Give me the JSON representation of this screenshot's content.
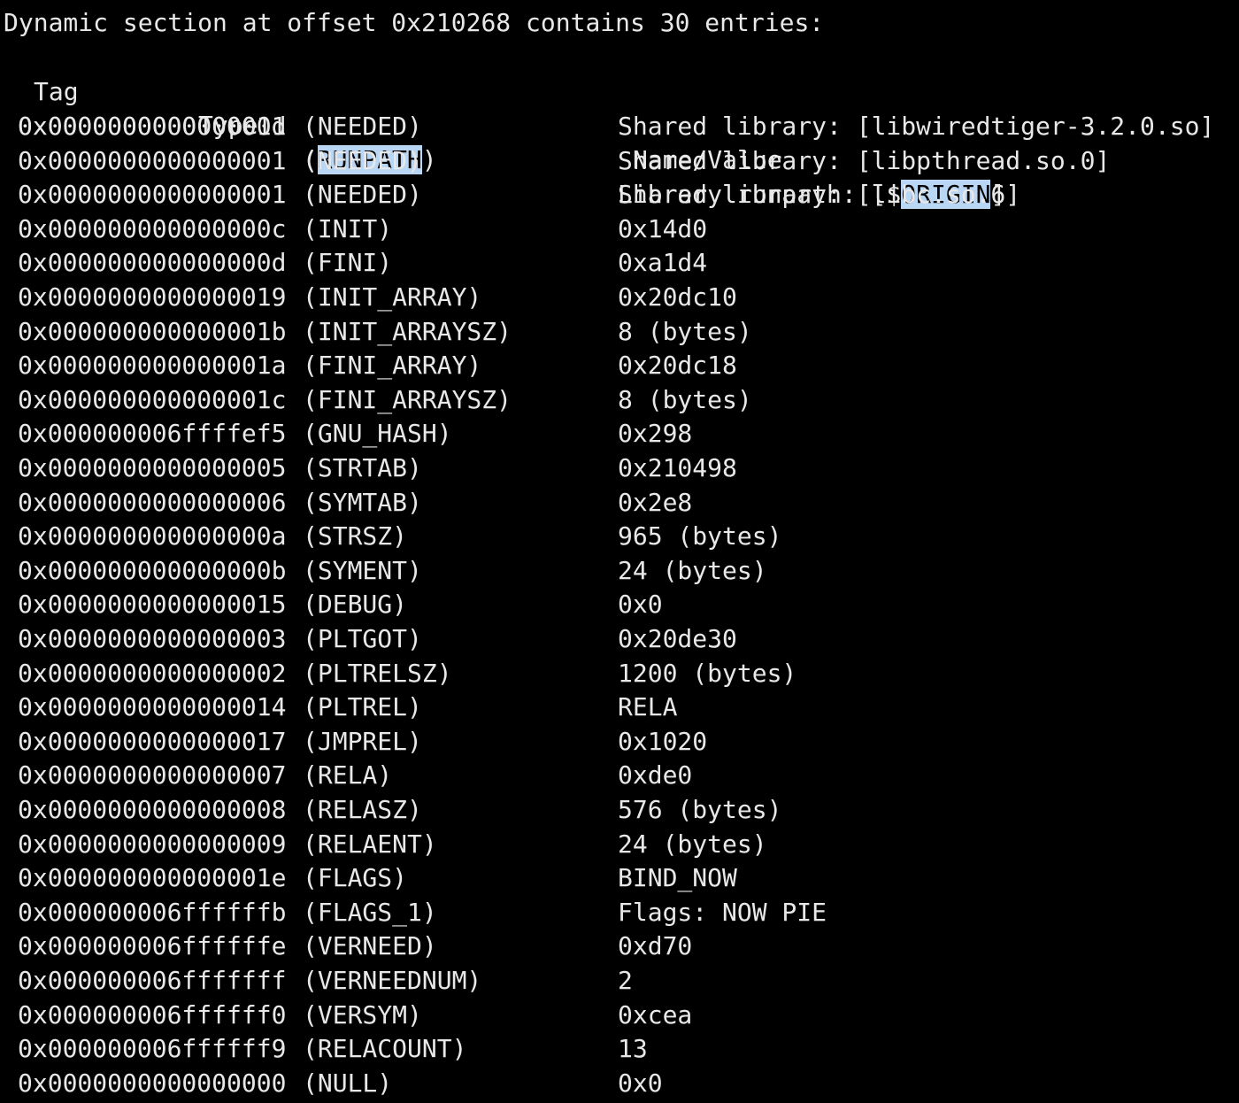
{
  "header": {
    "title": "Dynamic section at offset 0x210268 contains 30 entries:",
    "col_tag": "Tag",
    "col_type": "Type",
    "col_value": "Name/Value"
  },
  "selection": {
    "highlight_color": "#b9d6f5",
    "highlighted_words": [
      "RUNPATH",
      "ORIGIN"
    ]
  },
  "first_row": {
    "tag": "0x000000000000001d",
    "type_open": " (",
    "type_highlight": "RUNPATH",
    "type_close": ")",
    "value_prefix": "Library runpath: [$",
    "value_highlight": "ORIGIN",
    "value_suffix": "]"
  },
  "rows": [
    {
      "tag": "0x0000000000000001",
      "type": "(NEEDED)",
      "value": "Shared library: [libwiredtiger-3.2.0.so]"
    },
    {
      "tag": "0x0000000000000001",
      "type": "(NEEDED)",
      "value": "Shared library: [libpthread.so.0]"
    },
    {
      "tag": "0x0000000000000001",
      "type": "(NEEDED)",
      "value": "Shared library: [libc.so.6]"
    },
    {
      "tag": "0x000000000000000c",
      "type": "(INIT)",
      "value": "0x14d0"
    },
    {
      "tag": "0x000000000000000d",
      "type": "(FINI)",
      "value": "0xa1d4"
    },
    {
      "tag": "0x0000000000000019",
      "type": "(INIT_ARRAY)",
      "value": "0x20dc10"
    },
    {
      "tag": "0x000000000000001b",
      "type": "(INIT_ARRAYSZ)",
      "value": "8 (bytes)"
    },
    {
      "tag": "0x000000000000001a",
      "type": "(FINI_ARRAY)",
      "value": "0x20dc18"
    },
    {
      "tag": "0x000000000000001c",
      "type": "(FINI_ARRAYSZ)",
      "value": "8 (bytes)"
    },
    {
      "tag": "0x000000006ffffef5",
      "type": "(GNU_HASH)",
      "value": "0x298"
    },
    {
      "tag": "0x0000000000000005",
      "type": "(STRTAB)",
      "value": "0x210498"
    },
    {
      "tag": "0x0000000000000006",
      "type": "(SYMTAB)",
      "value": "0x2e8"
    },
    {
      "tag": "0x000000000000000a",
      "type": "(STRSZ)",
      "value": "965 (bytes)"
    },
    {
      "tag": "0x000000000000000b",
      "type": "(SYMENT)",
      "value": "24 (bytes)"
    },
    {
      "tag": "0x0000000000000015",
      "type": "(DEBUG)",
      "value": "0x0"
    },
    {
      "tag": "0x0000000000000003",
      "type": "(PLTGOT)",
      "value": "0x20de30"
    },
    {
      "tag": "0x0000000000000002",
      "type": "(PLTRELSZ)",
      "value": "1200 (bytes)"
    },
    {
      "tag": "0x0000000000000014",
      "type": "(PLTREL)",
      "value": "RELA"
    },
    {
      "tag": "0x0000000000000017",
      "type": "(JMPREL)",
      "value": "0x1020"
    },
    {
      "tag": "0x0000000000000007",
      "type": "(RELA)",
      "value": "0xde0"
    },
    {
      "tag": "0x0000000000000008",
      "type": "(RELASZ)",
      "value": "576 (bytes)"
    },
    {
      "tag": "0x0000000000000009",
      "type": "(RELAENT)",
      "value": "24 (bytes)"
    },
    {
      "tag": "0x000000000000001e",
      "type": "(FLAGS)",
      "value": "BIND_NOW"
    },
    {
      "tag": "0x000000006ffffffb",
      "type": "(FLAGS_1)",
      "value": "Flags: NOW PIE"
    },
    {
      "tag": "0x000000006ffffffe",
      "type": "(VERNEED)",
      "value": "0xd70"
    },
    {
      "tag": "0x000000006fffffff",
      "type": "(VERNEEDNUM)",
      "value": "2"
    },
    {
      "tag": "0x000000006ffffff0",
      "type": "(VERSYM)",
      "value": "0xcea"
    },
    {
      "tag": "0x000000006ffffff9",
      "type": "(RELACOUNT)",
      "value": "13"
    },
    {
      "tag": "0x0000000000000000",
      "type": "(NULL)",
      "value": "0x0"
    }
  ]
}
